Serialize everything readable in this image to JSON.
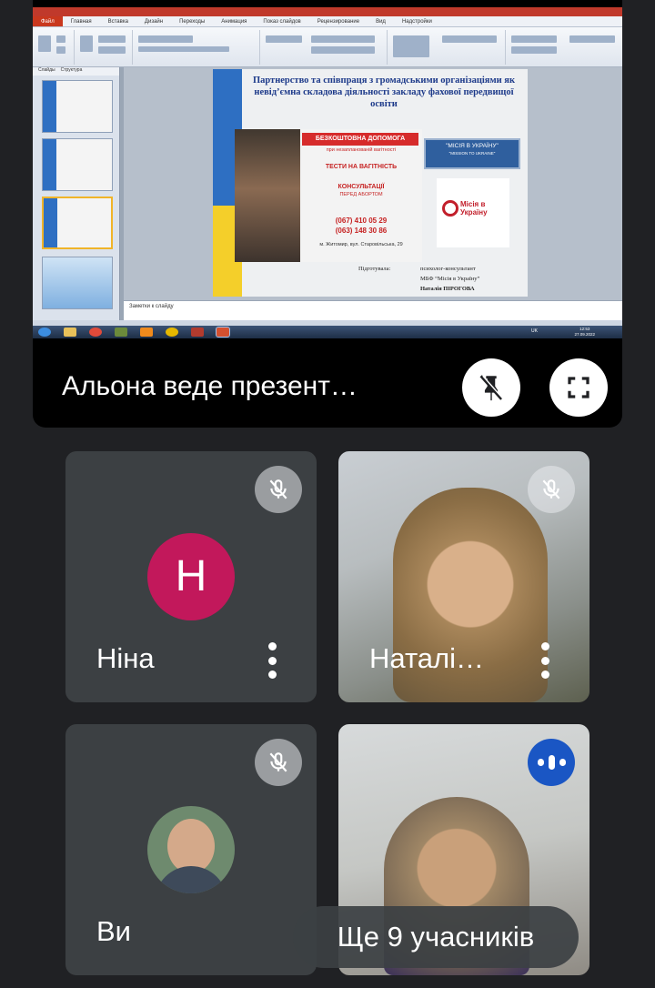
{
  "presentation": {
    "presenter_label": "Альона  веде презент…",
    "shared_screen": {
      "menu_tabs": [
        "Файл",
        "Главная",
        "Вставка",
        "Дизайн",
        "Переходы",
        "Анимация",
        "Показ слайдов",
        "Рецензирование",
        "Вид",
        "Надстройки"
      ],
      "thumbs_tabs": [
        "Слайды",
        "Структура"
      ],
      "slide_title": "Партнерство та співпраця з громадськими організаціями як невід’ємна складова діяльності закладу фахової передвищої освіти",
      "poster": {
        "headline": "БЕЗКОШТОВНА ДОПОМОГА",
        "subheadline": "при незапланованій вагітності",
        "tests": "ТЕСТИ НА ВАГІТНІСТЬ",
        "consult": "КОНСУЛЬТАЦІЇ",
        "consult_sub": "ПЕРЕД АБОРТОМ",
        "phone1": "(067) 410 05 29",
        "phone2": "(063) 148 30 86",
        "address": "м. Житомир, вул. Старовільська, 29"
      },
      "mission_badge": "\"МІСІЯ  В УКРАЇНУ\"",
      "mission_badge_en": "\"MISSION TO UKRAINE\"",
      "mission_logo": "Місія в Україну",
      "signature": {
        "prepared_label": "Підготувала:",
        "line1": "психолог-консультант",
        "line2": "МБФ “Місія в Україну”",
        "line3": "Наталія ПІРОГОВА"
      },
      "notes_placeholder": "Заметки к слайду",
      "clock_time": "12:53",
      "clock_date": "27.09.2022",
      "lang": "UK"
    }
  },
  "participants": [
    {
      "name": "Ніна",
      "avatar_letter": "H",
      "muted": true
    },
    {
      "name": "Наталі…",
      "muted": true
    },
    {
      "name": "Ви",
      "muted": true
    },
    {
      "name": "",
      "speaking": true
    }
  ],
  "more_participants": "Ще 9 учасників",
  "colors": {
    "background": "#202124",
    "tile": "#3c4043",
    "avatar_nina": "#c2185b",
    "speaking_badge": "#1a56c4"
  },
  "icons": {
    "unpin": "pin-off-icon",
    "fullscreen": "fullscreen-icon",
    "mic_off": "mic-off-icon",
    "more": "more-vert-icon",
    "speaking": "audio-level-icon"
  }
}
